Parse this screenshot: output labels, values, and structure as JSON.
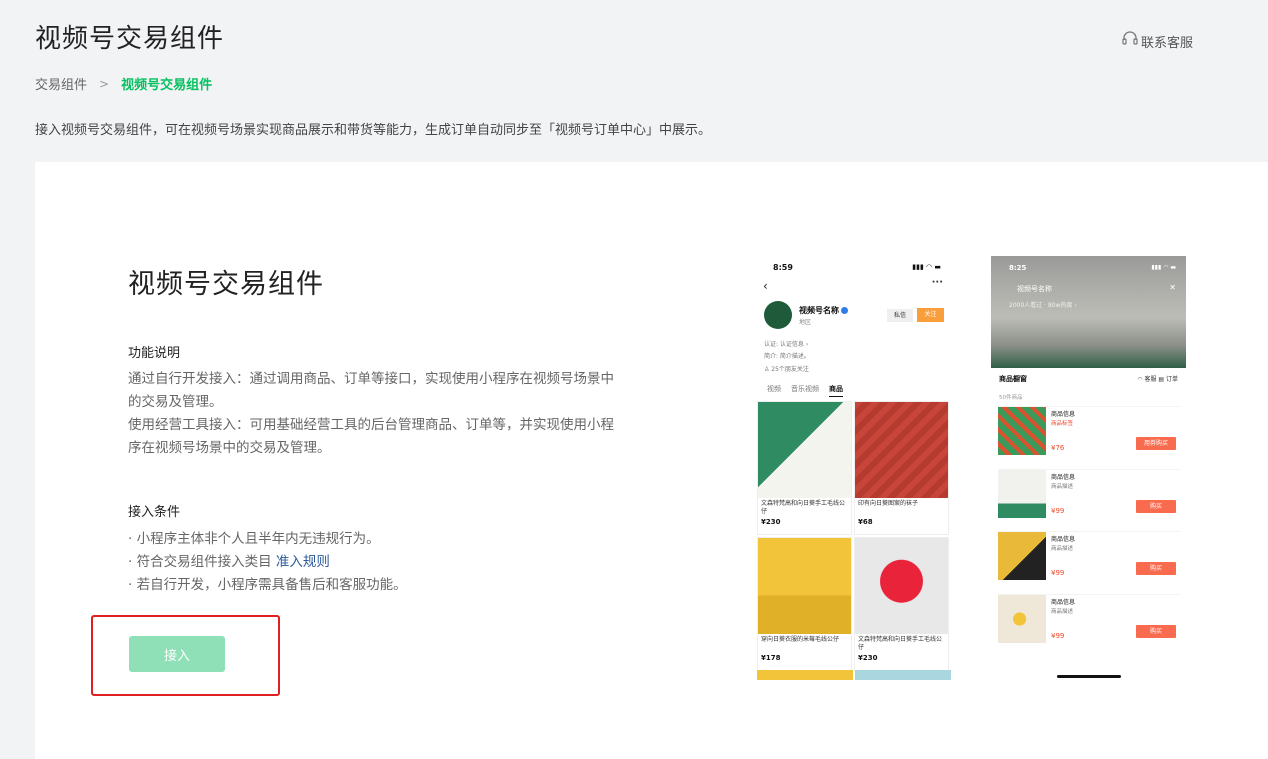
{
  "header": {
    "title": "视频号交易组件",
    "support_label": "联系客服"
  },
  "breadcrumb": {
    "first": "交易组件",
    "separator": ">",
    "current": "视频号交易组件"
  },
  "intro": "接入视频号交易组件，可在视频号场景实现商品展示和带货等能力，生成订单自动同步至「视频号订单中心」中展示。",
  "card": {
    "title": "视频号交易组件",
    "feature_title": "功能说明",
    "feature_desc_1": "通过自行开发接入：通过调用商品、订单等接口，实现使用小程序在视频号场景中的交易及管理。",
    "feature_desc_2": "使用经营工具接入：可用基础经营工具的后台管理商品、订单等，并实现使用小程序在视频号场景中的交易及管理。",
    "condition_title": "接入条件",
    "conditions": [
      "· 小程序主体非个人且半年内无违规行为。",
      "· 符合交易组件接入类目 ",
      "· 若自行开发，小程序需具备售后和客服功能。"
    ],
    "rule_link": "准入规则",
    "connect_button": "接入"
  },
  "phone1": {
    "time": "8:59",
    "status_icons": "▮▮▮ ◠ ▬",
    "more": "···",
    "channel_name": "视频号名称",
    "region": "地区",
    "message_btn": "私信",
    "follow_btn": "关注",
    "cert": "认证: 认证信息 ›",
    "bio": "简介: 简介描述。",
    "friends": "25个朋友关注",
    "tabs": [
      "视频",
      "音乐视频",
      "商品"
    ],
    "products": [
      {
        "caption": "文森特梵高和向日葵手工毛线公仔",
        "price": "¥230",
        "color": "#2e8b62"
      },
      {
        "caption": "印有向日葵图案的袜子",
        "price": "¥68",
        "color": "#c8453a"
      },
      {
        "caption": "穿向日葵衣服的米莓毛线公仔",
        "price": "¥178",
        "color": "#f2c43a"
      },
      {
        "caption": "文森特梵高和向日葵手工毛线公仔",
        "price": "¥230",
        "color": "#e8e8e8"
      }
    ]
  },
  "phone2": {
    "time": "8:25",
    "status_icons": "▮▮▮ ◠ ▬",
    "channel_name": "视频号名称",
    "sub": "2000人看过 · 80w热度 ›",
    "close": "✕",
    "shop_title": "商品橱窗",
    "actions": "◠ 客服   ▤ 订单",
    "count": "50件商品",
    "items": [
      {
        "name": "商品信息",
        "tag": "商品标签",
        "price": "¥76",
        "buy": "用券购买",
        "color": "#3a9a5c"
      },
      {
        "name": "商品信息",
        "tag": "商品描述",
        "price": "¥99",
        "buy": "购买",
        "color": "#f1f1ee"
      },
      {
        "name": "商品信息",
        "tag": "商品描述",
        "price": "¥99",
        "buy": "购买",
        "color": "#e9b93a"
      },
      {
        "name": "商品信息",
        "tag": "商品描述",
        "price": "¥99",
        "buy": "购买",
        "color": "#efe8d8"
      }
    ]
  }
}
